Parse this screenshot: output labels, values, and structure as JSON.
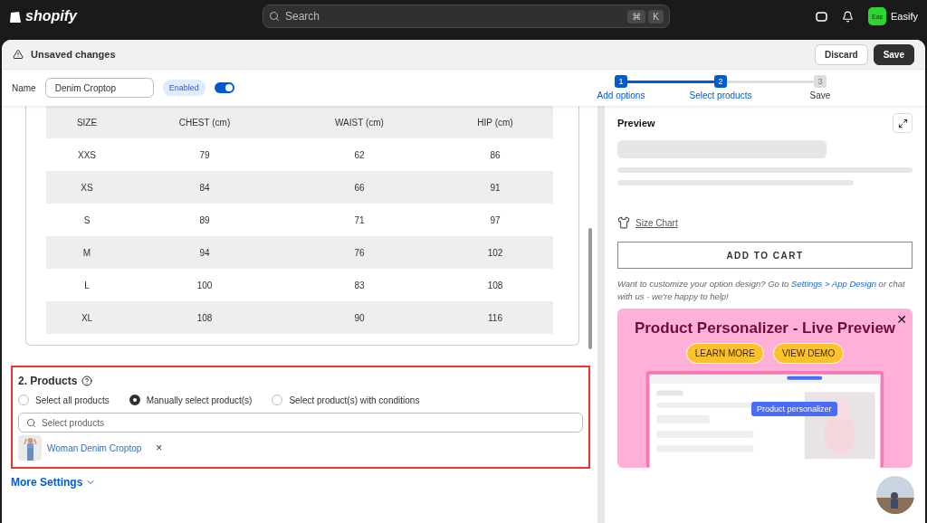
{
  "topbar": {
    "brand": "shopify",
    "search": {
      "placeholder": "Search",
      "keys": [
        "⌘",
        "K"
      ]
    },
    "store": {
      "initials": "Eas",
      "name": "Easify"
    }
  },
  "unsaved_bar": {
    "title": "Unsaved changes",
    "buttons": [
      "Discard",
      "Save"
    ]
  },
  "name_row": {
    "label": "Name",
    "value": "Denim Croptop",
    "status": "Enabled",
    "enabled": true
  },
  "steps": [
    {
      "number": "1",
      "label": "Add options",
      "done": true
    },
    {
      "number": "2",
      "label": "Select products",
      "done": true
    },
    {
      "number": "3",
      "label": "Save",
      "done": false
    }
  ],
  "size_table": {
    "columns": [
      "SIZE",
      "CHEST (cm)",
      "WAIST (cm)",
      "HIP (cm)"
    ],
    "rows": [
      [
        "XXS",
        "79",
        "62",
        "86"
      ],
      [
        "XS",
        "84",
        "66",
        "91"
      ],
      [
        "S",
        "89",
        "71",
        "97"
      ],
      [
        "M",
        "94",
        "76",
        "102"
      ],
      [
        "L",
        "100",
        "83",
        "108"
      ],
      [
        "XL",
        "108",
        "90",
        "116"
      ]
    ]
  },
  "products": {
    "title": "2. Products",
    "options": [
      {
        "label": "Select all products",
        "selected": false
      },
      {
        "label": "Manually select product(s)",
        "selected": true
      },
      {
        "label": "Select product(s) with conditions",
        "selected": false
      }
    ],
    "search": {
      "placeholder": "Select products"
    },
    "items": [
      {
        "name": "Woman Denim Croptop",
        "remove": "×"
      }
    ]
  },
  "more_settings": "More Settings",
  "preview": {
    "title": "Preview",
    "size_chart": "Size Chart",
    "add_to_cart": "ADD TO CART",
    "note_before": "Want to customize your option design? Go to",
    "note_link": "Settings > App Design",
    "note_after": "or chat with us - we're happy to help!",
    "banner": {
      "title": "Product Personalizer - Live Preview",
      "buttons": [
        "LEARN MORE",
        "VIEW DEMO"
      ],
      "tag": "Product personalizer",
      "close": "✕"
    }
  }
}
